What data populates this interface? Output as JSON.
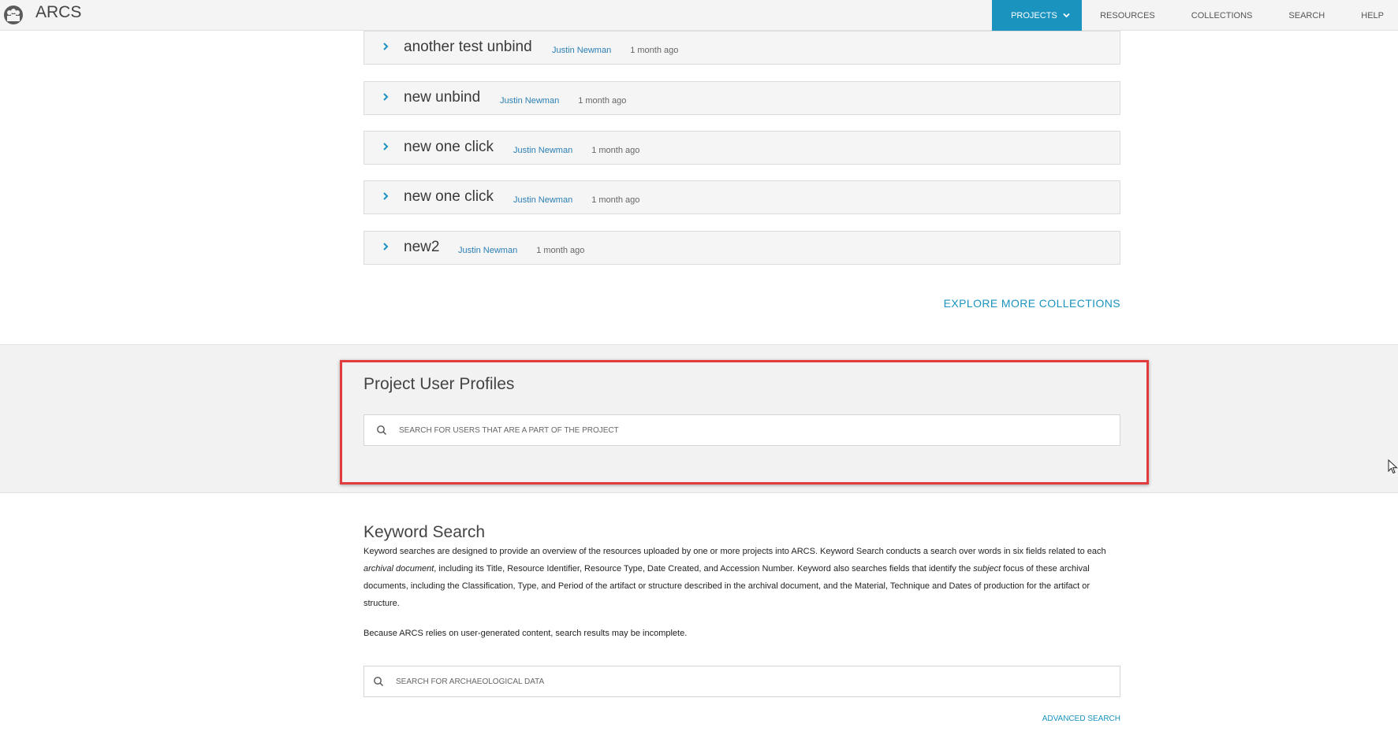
{
  "app": {
    "title": "ARCS"
  },
  "nav": [
    {
      "label": "PROJECTS",
      "active": true
    },
    {
      "label": "RESOURCES"
    },
    {
      "label": "COLLECTIONS"
    },
    {
      "label": "SEARCH"
    },
    {
      "label": "HELP"
    }
  ],
  "collections": [
    {
      "title": "another test unbind",
      "author": "Justin Newman",
      "when": "1 month ago"
    },
    {
      "title": "new unbind",
      "author": "Justin Newman",
      "when": "1 month ago"
    },
    {
      "title": "new one click",
      "author": "Justin Newman",
      "when": "1 month ago"
    },
    {
      "title": "new one click",
      "author": "Justin Newman",
      "when": "1 month ago"
    },
    {
      "title": "new2",
      "author": "Justin Newman",
      "when": "1 month ago"
    }
  ],
  "explore": {
    "label": "EXPLORE MORE COLLECTIONS"
  },
  "profiles": {
    "title": "Project User Profiles",
    "placeholder": "SEARCH FOR USERS THAT ARE A PART OF THE PROJECT"
  },
  "keyword": {
    "title": "Keyword Search",
    "para1": {
      "a": "Keyword searches are designed to provide an overview of the resources uploaded by one or more projects into ARCS. Keyword Search conducts a search over words in six fields related to each ",
      "b": "archival document",
      "c": ", including its Title, Resource Identifier, Resource Type, Date Created, and Accession Number. Keyword also searches fields that identify the ",
      "d": "subject",
      "e": " focus of these archival documents, including the Classification, Type, and Period of the artifact or structure described in the archival document, and the Material, Technique and Dates of production for the artifact or structure."
    },
    "para2": "Because ARCS relies on user-generated content, search results may be incomplete.",
    "placeholder": "SEARCH FOR ARCHAEOLOGICAL DATA",
    "advanced_label": "ADVANCED SEARCH"
  },
  "colors": {
    "accent": "#1a93bf",
    "highlight": "#e23b3b",
    "link": "#2b7fb4"
  },
  "icons": {
    "logo": "arcs-logo-icon",
    "chevron": "chevron-right-icon",
    "search": "search-icon",
    "caret": "chevron-down-icon"
  }
}
